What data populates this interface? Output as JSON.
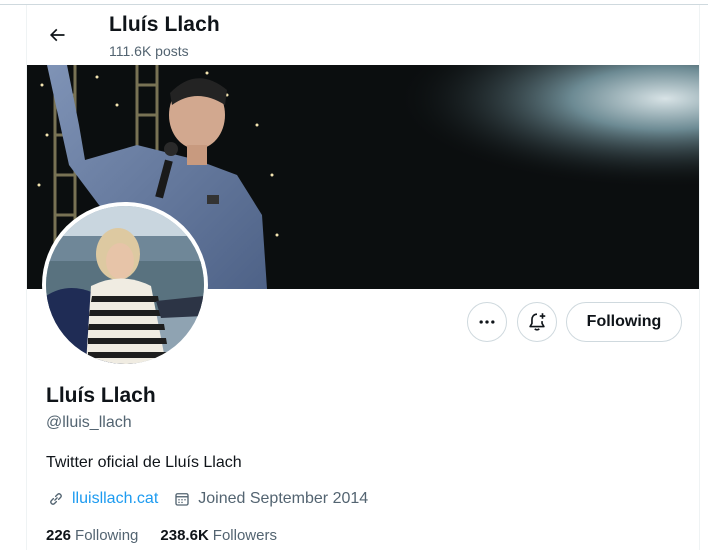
{
  "header": {
    "back_icon": "arrow-left-icon",
    "title": "Lluís Llach",
    "posts_count": "111.6K posts"
  },
  "banner": {
    "description_icon": "banner-image"
  },
  "actions": {
    "more_icon": "more-dots-icon",
    "notify_icon": "bell-plus-icon",
    "following_label": "Following"
  },
  "profile": {
    "name": "Lluís Llach",
    "handle": "@lluis_llach",
    "bio": "Twitter oficial de Lluís Llach",
    "website": "lluisllach.cat",
    "joined": "Joined September 2014"
  },
  "stats": {
    "following_count": "226",
    "following_label": "Following",
    "followers_count": "238.6K",
    "followers_label": "Followers"
  },
  "colors": {
    "link": "#1d9bf0",
    "secondary_text": "#536471",
    "primary_text": "#0f1419",
    "border": "#cfd9de"
  }
}
